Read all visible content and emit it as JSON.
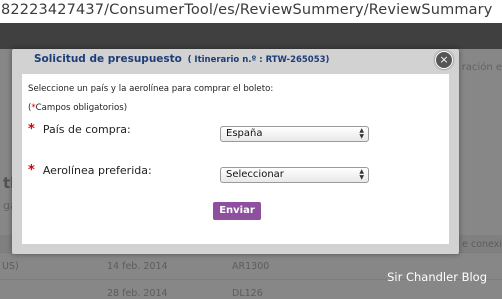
{
  "browser": {
    "url": "82223427437/ConsumerTool/es/ReviewSummery/ReviewSummary"
  },
  "background": {
    "right_top_text": "ración e",
    "section_title": "th",
    "section_sub": "ga",
    "header_right": "e conexi",
    "rows": [
      {
        "col1": "US)",
        "col2": "14 feb. 2014",
        "col3": "AR1300"
      },
      {
        "col1": "",
        "col2": "28 feb. 2014",
        "col3": "DL126"
      }
    ]
  },
  "modal": {
    "title": "Solicitud de presupuesto",
    "subtitle": "( Itinerario n.º : RTW-265053)",
    "close_symbol": "×",
    "instruction": "Seleccione un país y la aerolínea para comprar el boleto:",
    "required_note_open": "(",
    "required_note_star": "*",
    "required_note_text": "Campos obligatorios)",
    "fields": {
      "country_label": "País de compra:",
      "country_value": "España",
      "airline_label": "Aerolínea preferida:",
      "airline_value": "Seleccionar",
      "required_marker": "*"
    },
    "submit_label": "Enviar"
  },
  "watermark": "Sir Chandler Blog",
  "colors": {
    "title": "#1d3d78",
    "required": "#d40000",
    "submit": "#8d4f9e"
  }
}
